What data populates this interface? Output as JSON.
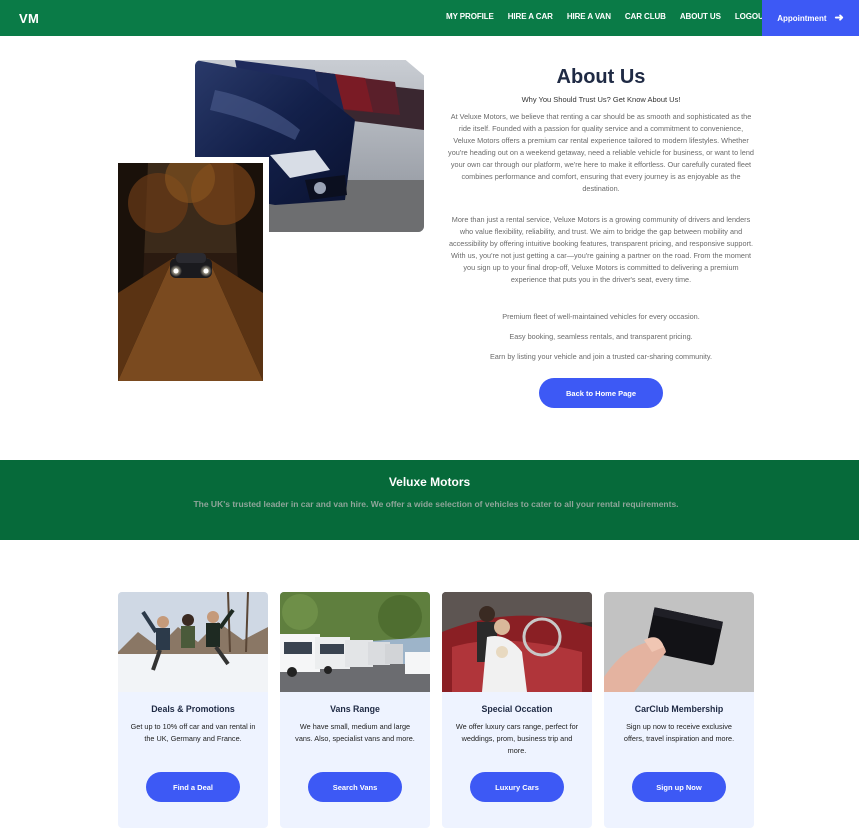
{
  "nav": {
    "brand": "VM",
    "links": [
      "MY PROFILE",
      "HIRE A CAR",
      "HIRE A VAN",
      "CAR CLUB",
      "ABOUT US",
      "LOGOUT"
    ],
    "appointment_label": "Appointment",
    "appointment_icon": "arrow-right-icon"
  },
  "about": {
    "title": "About Us",
    "subtitle": "Why You Should Trust Us? Get Know About Us!",
    "paragraph1": "At Veluxe Motors, we believe that renting a car should be as smooth and sophisticated as the ride itself. Founded with a passion for quality service and a commitment to convenience, Veluxe Motors offers a premium car rental experience tailored to modern lifestyles. Whether you're heading out on a weekend getaway, need a reliable vehicle for business, or want to lend your own car through our platform, we're here to make it effortless. Our carefully curated fleet combines performance and comfort, ensuring that every journey is as enjoyable as the destination.",
    "paragraph2": "More than just a rental service, Veluxe Motors is a growing community of drivers and lenders who value flexibility, reliability, and trust. We aim to bridge the gap between mobility and accessibility by offering intuitive booking features, transparent pricing, and responsive support. With us, you're not just getting a car—you're gaining a partner on the road. From the moment you sign up to your final drop-off, Veluxe Motors is committed to delivering a premium experience that puts you in the driver's seat, every time.",
    "features": [
      "Premium fleet of well-maintained vehicles for every occasion.",
      "Easy booking, seamless rentals, and transparent pricing.",
      "Earn by listing your vehicle and join a trusted car-sharing community."
    ],
    "back_button": "Back to Home Page"
  },
  "banner": {
    "title": "Veluxe Motors",
    "text": "The UK's trusted leader in car and van hire. We offer a wide selection of vehicles to cater to all your rental requirements."
  },
  "cards": [
    {
      "title": "Deals & Promotions",
      "text": "Get up to 10% off car and van rental in the UK, Germany and France.",
      "button": "Find a Deal"
    },
    {
      "title": "Vans Range",
      "text": "We have small, medium and large vans. Also, specialist vans and more.",
      "button": "Search Vans"
    },
    {
      "title": "Special Occation",
      "text": "We offer luxury cars range, perfect for weddings, prom, business trip and more.",
      "button": "Luxury Cars"
    },
    {
      "title": "CarClub Membership",
      "text": "Sign up now to receive exclusive offers, travel inspiration and more.",
      "button": "Sign up Now"
    }
  ],
  "colors": {
    "nav_green": "#0a7b47",
    "banner_green": "#066a3a",
    "accent_blue": "#3d59f5",
    "card_bg": "#eef3ff"
  }
}
